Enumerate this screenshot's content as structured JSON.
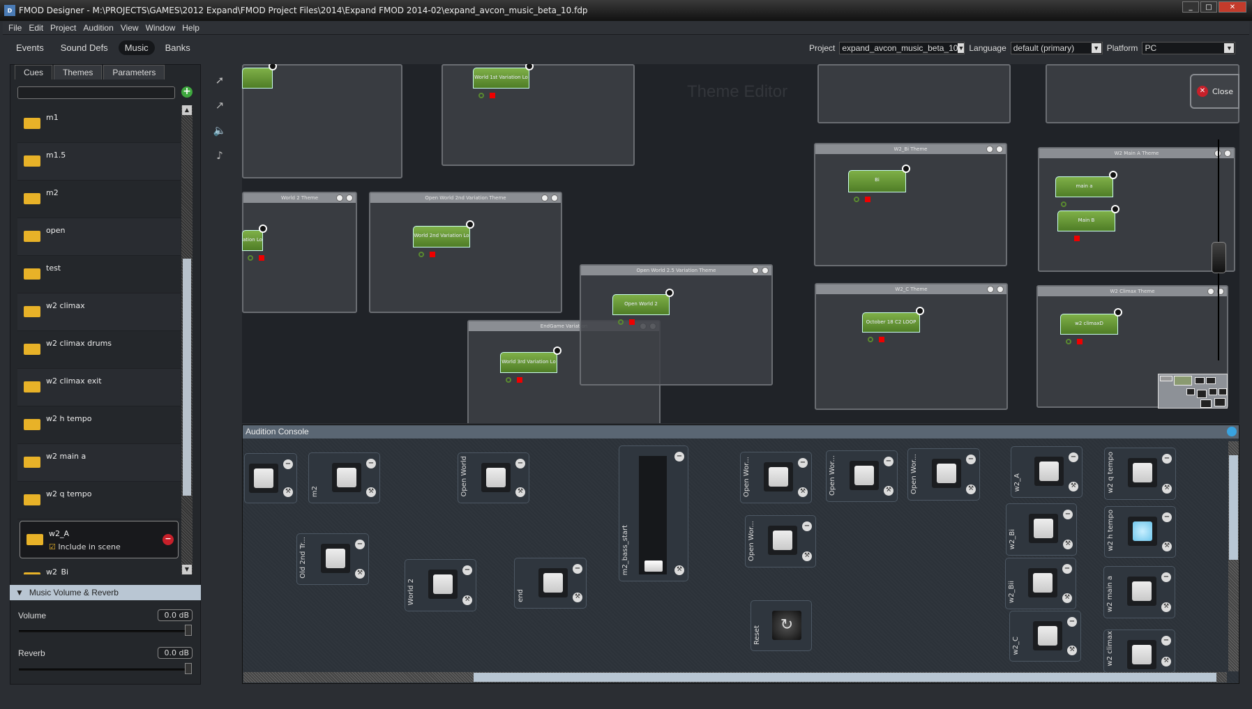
{
  "window": {
    "title": "FMOD Designer - M:\\PROJECTS\\GAMES\\2012 Expand\\FMOD Project Files\\2014\\Expand FMOD 2014-02\\expand_avcon_music_beta_10.fdp"
  },
  "menu": [
    "File",
    "Edit",
    "Project",
    "Audition",
    "View",
    "Window",
    "Help"
  ],
  "nav_tabs": [
    {
      "label": "Events"
    },
    {
      "label": "Sound Defs"
    },
    {
      "label": "Music",
      "active": true
    },
    {
      "label": "Banks"
    }
  ],
  "project_bar": {
    "project_label": "Project",
    "project_value": "expand_avcon_music_beta_10",
    "language_label": "Language",
    "language_value": "default (primary)",
    "platform_label": "Platform",
    "platform_value": "PC"
  },
  "left_tabs": [
    {
      "label": "Cues",
      "active": true
    },
    {
      "label": "Themes"
    },
    {
      "label": "Parameters"
    }
  ],
  "search": {
    "value": "",
    "placeholder": ""
  },
  "cues": [
    {
      "name": "m1"
    },
    {
      "name": "m1.5"
    },
    {
      "name": "m2"
    },
    {
      "name": "open"
    },
    {
      "name": "test"
    },
    {
      "name": "w2 climax"
    },
    {
      "name": "w2 climax drums"
    },
    {
      "name": "w2 climax exit"
    },
    {
      "name": "w2 h tempo"
    },
    {
      "name": "w2 main a"
    },
    {
      "name": "w2 q tempo"
    },
    {
      "name": "w2_A",
      "selected": true,
      "include_label": "Include in scene",
      "include_checked": true
    },
    {
      "name": "w2_Bi"
    }
  ],
  "volume_reverb": {
    "header": "Music Volume & Reverb",
    "volume_label": "Volume",
    "volume_value": "0.0 dB",
    "reverb_label": "Reverb",
    "reverb_value": "0.0 dB",
    "volume_level": 1.0,
    "reverb_level": 1.0
  },
  "theme_editor": {
    "watermark": "Theme Editor",
    "close_label": "Close",
    "themes": [
      {
        "title": "",
        "nodes": [
          {
            "name": ""
          }
        ]
      },
      {
        "title": "",
        "nodes": [
          {
            "name": "World 1st Variation Lo"
          }
        ]
      },
      {
        "title": "World 2 Theme",
        "nodes": [
          {
            "name": "ation Lo"
          }
        ]
      },
      {
        "title": "Open World 2nd Variation Theme",
        "nodes": [
          {
            "name": "World 2nd Variation Lo"
          }
        ]
      },
      {
        "title": "EndGame Variation",
        "nodes": [
          {
            "name": "World 3rd Variation Lo"
          }
        ]
      },
      {
        "title": "Open World 2.5 Variation Theme",
        "nodes": [
          {
            "name": "Open World 2"
          }
        ]
      },
      {
        "title": "",
        "nodes": []
      },
      {
        "title": "",
        "nodes": []
      },
      {
        "title": "W2_Bi Theme",
        "nodes": [
          {
            "name": "Bi"
          }
        ]
      },
      {
        "title": "W2 Main A Theme",
        "nodes": [
          {
            "name": "main a"
          },
          {
            "name": "Main B"
          }
        ]
      },
      {
        "title": "W2_C Theme",
        "nodes": [
          {
            "name": "October 18 C2 LOOP"
          }
        ]
      },
      {
        "title": "W2 Climax Theme",
        "nodes": [
          {
            "name": "w2 climaxD"
          }
        ]
      }
    ]
  },
  "audition_console": {
    "title": "Audition Console",
    "controls": [
      {
        "label": ""
      },
      {
        "label": "m2"
      },
      {
        "label": "Open World"
      },
      {
        "label": "Old 2nd Tr..."
      },
      {
        "label": "World 2"
      },
      {
        "label": "end"
      },
      {
        "label": "Open Wor..."
      },
      {
        "label": "Open Wor..."
      },
      {
        "label": "Open Wor..."
      },
      {
        "label": "Open Wor..."
      },
      {
        "label": "w2_A"
      },
      {
        "label": "w2_Bi"
      },
      {
        "label": "w2_Bii"
      },
      {
        "label": "w2_C"
      },
      {
        "label": "w2 q tempo"
      },
      {
        "label": "w2 h tempo",
        "active": true
      },
      {
        "label": "w2 main a"
      },
      {
        "label": "w2 climax"
      }
    ],
    "slider": {
      "label": "m2_bass_start",
      "value": 0.0
    },
    "reset_label": "Reset"
  },
  "colors": {
    "node_green": "#6a9a38",
    "folder": "#e8b228",
    "active_pad": "#8fd6f2",
    "remove": "#c8202a"
  }
}
